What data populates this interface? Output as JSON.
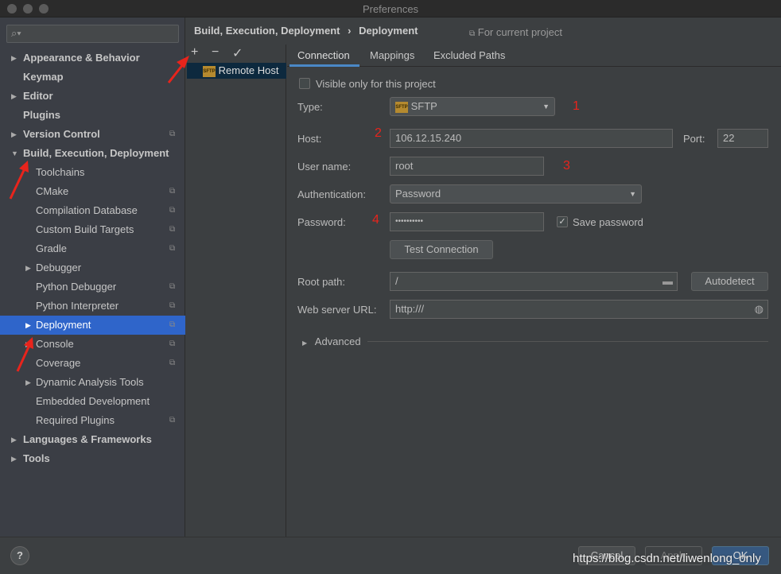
{
  "window": {
    "title": "Preferences"
  },
  "sidebar": {
    "search_placeholder": "",
    "items": [
      {
        "label": "Appearance & Behavior",
        "level": 0,
        "bold": true,
        "arrow": "right",
        "copy": false
      },
      {
        "label": "Keymap",
        "level": 0,
        "bold": true,
        "arrow": "",
        "copy": false
      },
      {
        "label": "Editor",
        "level": 0,
        "bold": true,
        "arrow": "right",
        "copy": false
      },
      {
        "label": "Plugins",
        "level": 0,
        "bold": true,
        "arrow": "",
        "copy": false
      },
      {
        "label": "Version Control",
        "level": 0,
        "bold": true,
        "arrow": "right",
        "copy": true
      },
      {
        "label": "Build, Execution, Deployment",
        "level": 0,
        "bold": true,
        "arrow": "down",
        "copy": false
      },
      {
        "label": "Toolchains",
        "level": 1,
        "arrow": "",
        "copy": false
      },
      {
        "label": "CMake",
        "level": 1,
        "arrow": "",
        "copy": true
      },
      {
        "label": "Compilation Database",
        "level": 1,
        "arrow": "",
        "copy": true
      },
      {
        "label": "Custom Build Targets",
        "level": 1,
        "arrow": "",
        "copy": true
      },
      {
        "label": "Gradle",
        "level": 1,
        "arrow": "",
        "copy": true
      },
      {
        "label": "Debugger",
        "level": 1,
        "arrow": "right",
        "copy": false
      },
      {
        "label": "Python Debugger",
        "level": 1,
        "arrow": "",
        "copy": true
      },
      {
        "label": "Python Interpreter",
        "level": 1,
        "arrow": "",
        "copy": true
      },
      {
        "label": "Deployment",
        "level": 1,
        "arrow": "right",
        "copy": true,
        "selected": true
      },
      {
        "label": "Console",
        "level": 1,
        "arrow": "right",
        "copy": true
      },
      {
        "label": "Coverage",
        "level": 1,
        "arrow": "",
        "copy": true
      },
      {
        "label": "Dynamic Analysis Tools",
        "level": 1,
        "arrow": "right",
        "copy": false
      },
      {
        "label": "Embedded Development",
        "level": 1,
        "arrow": "",
        "copy": false
      },
      {
        "label": "Required Plugins",
        "level": 1,
        "arrow": "",
        "copy": true
      },
      {
        "label": "Languages & Frameworks",
        "level": 0,
        "bold": true,
        "arrow": "right",
        "copy": false
      },
      {
        "label": "Tools",
        "level": 0,
        "bold": true,
        "arrow": "right",
        "copy": false
      }
    ]
  },
  "breadcrumb": {
    "parent": "Build, Execution, Deployment",
    "sep": "›",
    "current": "Deployment",
    "scope": "For current project"
  },
  "server_list": {
    "add": "+",
    "remove": "−",
    "default": "✓",
    "items": [
      {
        "label": "Remote Host",
        "icon": "sftp-icon",
        "selected": true
      }
    ]
  },
  "tabs": [
    {
      "label": "Connection",
      "active": true
    },
    {
      "label": "Mappings"
    },
    {
      "label": "Excluded Paths"
    }
  ],
  "form": {
    "visible_only": {
      "label": "Visible only for this project",
      "checked": false
    },
    "type": {
      "label": "Type:",
      "value": "SFTP"
    },
    "host": {
      "label": "Host:",
      "value": "106.12.15.240"
    },
    "port": {
      "label": "Port:",
      "value": "22"
    },
    "user": {
      "label": "User name:",
      "value": "root"
    },
    "auth": {
      "label": "Authentication:",
      "value": "Password"
    },
    "password": {
      "label": "Password:",
      "value": "••••••••••"
    },
    "save_password": {
      "label": "Save password",
      "checked": true
    },
    "test_connection": "Test Connection",
    "root_path": {
      "label": "Root path:",
      "value": "/"
    },
    "autodetect": "Autodetect",
    "web_url": {
      "label": "Web server URL:",
      "value": "http:///"
    },
    "advanced": "Advanced"
  },
  "annotations": {
    "n1": "1",
    "n2": "2",
    "n3": "3",
    "n4": "4",
    "color": "#e8241c"
  },
  "footer": {
    "help": "?",
    "cancel": "Cancel",
    "apply": "Apply",
    "ok": "OK"
  },
  "watermark": "https://blog.csdn.net/liwenlong_only",
  "colors": {
    "selection": "#2f65ca",
    "accent": "#4a88c7"
  }
}
